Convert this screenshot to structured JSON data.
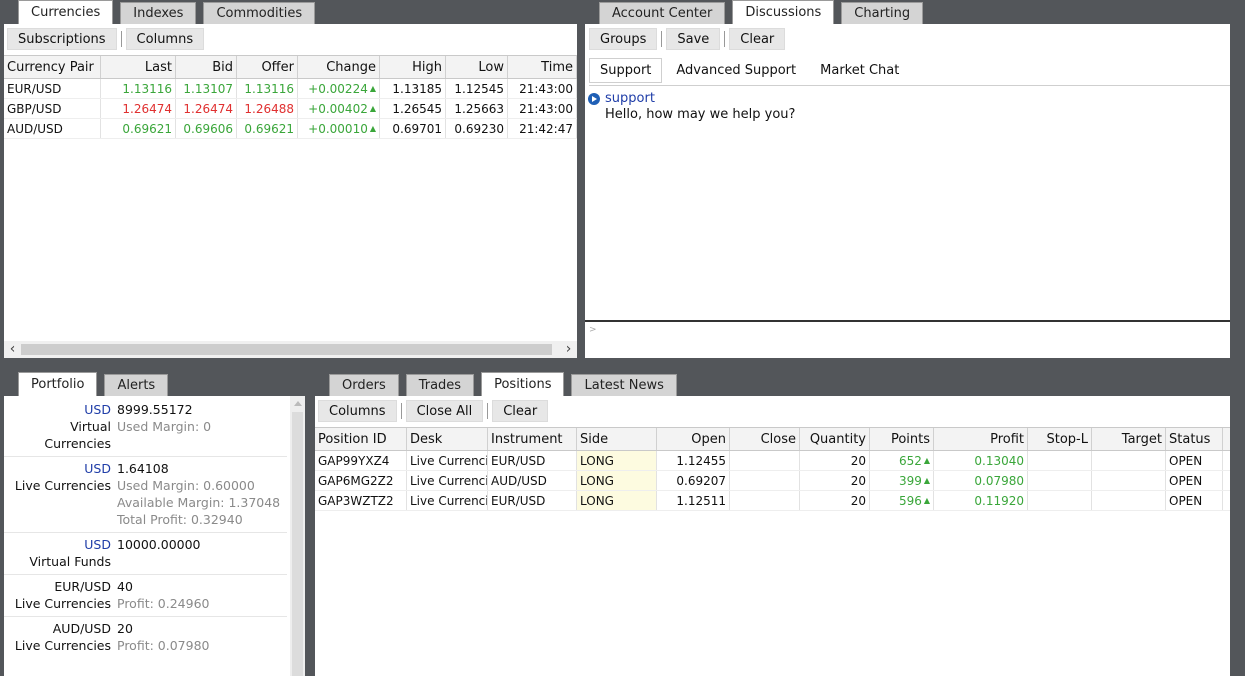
{
  "top_left": {
    "tabs": [
      "Currencies",
      "Indexes",
      "Commodities"
    ],
    "toolbar": [
      "Subscriptions",
      "Columns"
    ],
    "columns": [
      "Currency Pair",
      "Last",
      "Bid",
      "Offer",
      "Change",
      "High",
      "Low",
      "Time"
    ],
    "rows": [
      {
        "pair": "EUR/USD",
        "last": "1.13116",
        "bid": "1.13107",
        "offer": "1.13116",
        "change": "+0.00224",
        "high": "1.13185",
        "low": "1.12545",
        "time": "21:43:00",
        "dir": "up"
      },
      {
        "pair": "GBP/USD",
        "last": "1.26474",
        "bid": "1.26474",
        "offer": "1.26488",
        "change": "+0.00402",
        "high": "1.26545",
        "low": "1.25663",
        "time": "21:43:00",
        "dir": "dn"
      },
      {
        "pair": "AUD/USD",
        "last": "0.69621",
        "bid": "0.69606",
        "offer": "0.69621",
        "change": "+0.00010",
        "high": "0.69701",
        "low": "0.69230",
        "time": "21:42:47",
        "dir": "up"
      }
    ],
    "scroll_left": "‹",
    "scroll_right": "›"
  },
  "top_right": {
    "tabs": [
      "Account Center",
      "Discussions",
      "Charting"
    ],
    "toolbar": [
      "Groups",
      "Save",
      "Clear"
    ],
    "subtabs": [
      "Support",
      "Advanced Support",
      "Market Chat"
    ],
    "chat": {
      "user": "support",
      "message": "Hello, how may we help you?"
    },
    "input_prompt": ">"
  },
  "bottom_left": {
    "tabs": [
      "Portfolio",
      "Alerts"
    ],
    "entries": [
      {
        "currency": "USD",
        "category": "Virtual Currencies",
        "lines": [
          {
            "label": "",
            "value": "8999.55172"
          },
          {
            "label": "Used Margin: ",
            "value": "0"
          }
        ]
      },
      {
        "currency": "USD",
        "category": "Live Currencies",
        "lines": [
          {
            "label": "",
            "value": "1.64108"
          },
          {
            "label": "Used Margin: ",
            "value": "0.60000"
          },
          {
            "label": "Available Margin: ",
            "value": "1.37048"
          },
          {
            "label": "Total Profit: ",
            "value": "0.32940"
          }
        ]
      },
      {
        "currency": "USD",
        "category": "Virtual Funds",
        "lines": [
          {
            "label": "",
            "value": "10000.00000"
          }
        ]
      },
      {
        "currency": "EUR/USD",
        "category": "Live Currencies",
        "lines": [
          {
            "label": "",
            "value": "40"
          },
          {
            "label": "Profit: ",
            "value": "0.24960"
          }
        ]
      },
      {
        "currency": "AUD/USD",
        "category": "Live Currencies",
        "lines": [
          {
            "label": "",
            "value": "20"
          },
          {
            "label": "Profit: ",
            "value": "0.07980"
          }
        ]
      }
    ]
  },
  "bottom_right": {
    "tabs": [
      "Orders",
      "Trades",
      "Positions",
      "Latest News"
    ],
    "toolbar": [
      "Columns",
      "Close All",
      "Clear"
    ],
    "columns": [
      "Position ID",
      "Desk",
      "Instrument",
      "Side",
      "Open",
      "Close",
      "Quantity",
      "Points",
      "Profit",
      "Stop-L",
      "Target",
      "Status"
    ],
    "rows": [
      {
        "id": "GAP99YXZ4",
        "desk": "Live Currencies",
        "instrument": "EUR/USD",
        "side": "LONG",
        "open": "1.12455",
        "close": "",
        "quantity": "20",
        "points": "652",
        "profit": "0.13040",
        "stop": "",
        "target": "",
        "status": "OPEN"
      },
      {
        "id": "GAP6MG2Z2",
        "desk": "Live Currencies",
        "instrument": "AUD/USD",
        "side": "LONG",
        "open": "0.69207",
        "close": "",
        "quantity": "20",
        "points": "399",
        "profit": "0.07980",
        "stop": "",
        "target": "",
        "status": "OPEN"
      },
      {
        "id": "GAP3WZTZ2",
        "desk": "Live Currencies",
        "instrument": "EUR/USD",
        "side": "LONG",
        "open": "1.12511",
        "close": "",
        "quantity": "20",
        "points": "596",
        "profit": "0.11920",
        "stop": "",
        "target": "",
        "status": "OPEN"
      }
    ]
  },
  "colors": {
    "up": "#3aa63a",
    "down": "#e03030",
    "link": "#1f3da8",
    "long_bg": "#fdfbe0"
  }
}
